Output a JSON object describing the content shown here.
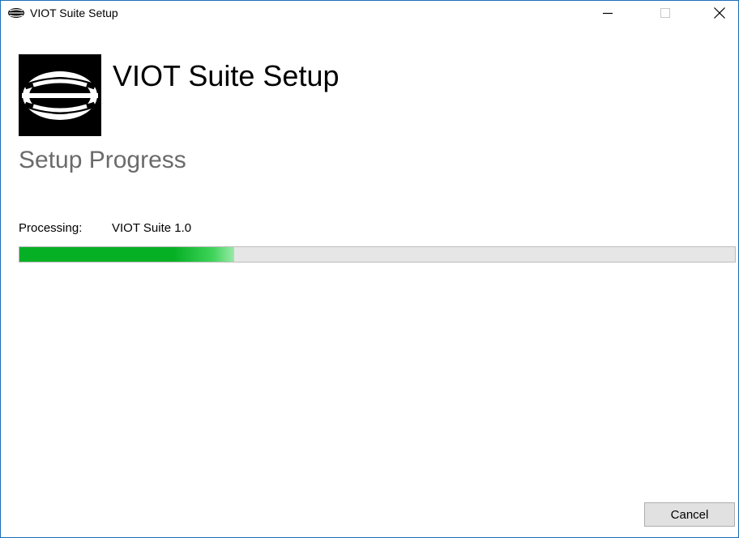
{
  "window": {
    "title": "VIOT Suite Setup",
    "border_color": "#1a6fb8"
  },
  "controls": {
    "minimize_icon": "minimize-icon",
    "maximize_icon": "maximize-icon",
    "close_icon": "close-icon"
  },
  "header": {
    "app_title": "VIOT Suite Setup",
    "logo_icon": "globe-logo-icon"
  },
  "main": {
    "section_title": "Setup Progress",
    "processing_label": "Processing:",
    "processing_value": "VIOT Suite 1.0",
    "progress": {
      "percent": 30,
      "fill_color": "#06b025",
      "track_color": "#e6e6e6"
    }
  },
  "footer": {
    "cancel_label": "Cancel"
  }
}
